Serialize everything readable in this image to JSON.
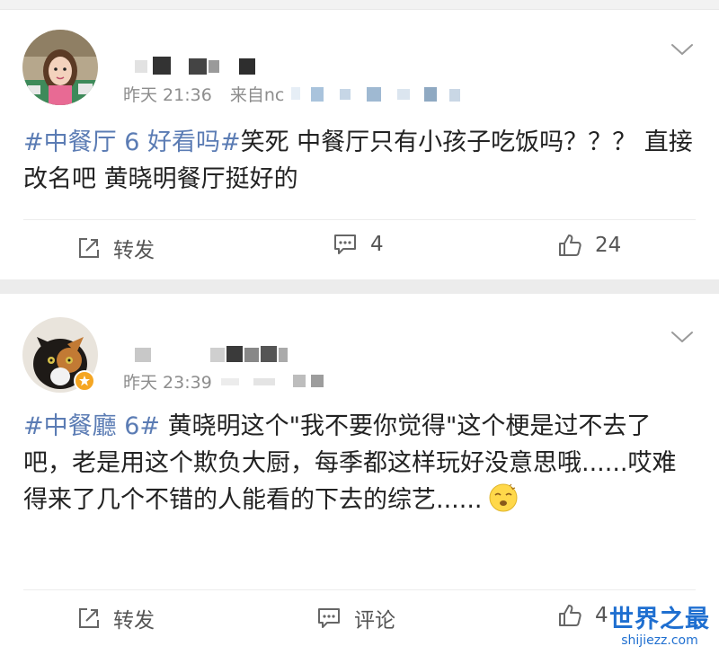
{
  "posts": [
    {
      "time": "昨天 21:36",
      "source_prefix": "来自",
      "source_visible": "nc",
      "text_tag": "#中餐厅 6 好看吗#",
      "text_body": "笑死 中餐厅只有小孩子吃饭吗？？？ 直接改名吧 黄晓明餐厅挺好的",
      "actions": {
        "share": "转发",
        "comment": "4",
        "like": "24"
      }
    },
    {
      "time": "昨天 23:39",
      "text_tag": "#中餐廳 6#",
      "text_body": " 黄晓明这个\"我不要你觉得\"这个梗是过不去了吧，老是用这个欺负大厨，每季都这样玩好没意思哦......哎难得来了几个不错的人能看的下去的综艺......",
      "actions": {
        "share": "转发",
        "comment": "评论",
        "like": "4"
      }
    }
  ],
  "watermark": {
    "main": "世界之最",
    "sub": "shijiezz.com"
  },
  "colors": {
    "tag": "#5b7cb4",
    "meta": "#8d8d8d",
    "watermark": "#1f6fd0",
    "badge": "#f5a623"
  },
  "icons": {
    "share": "share-icon",
    "comment": "comment-icon",
    "like": "thumbs-up-icon",
    "menu": "chevron-down-icon",
    "badge": "verified-badge-icon",
    "emoji": "dizzy-face-emoji"
  }
}
